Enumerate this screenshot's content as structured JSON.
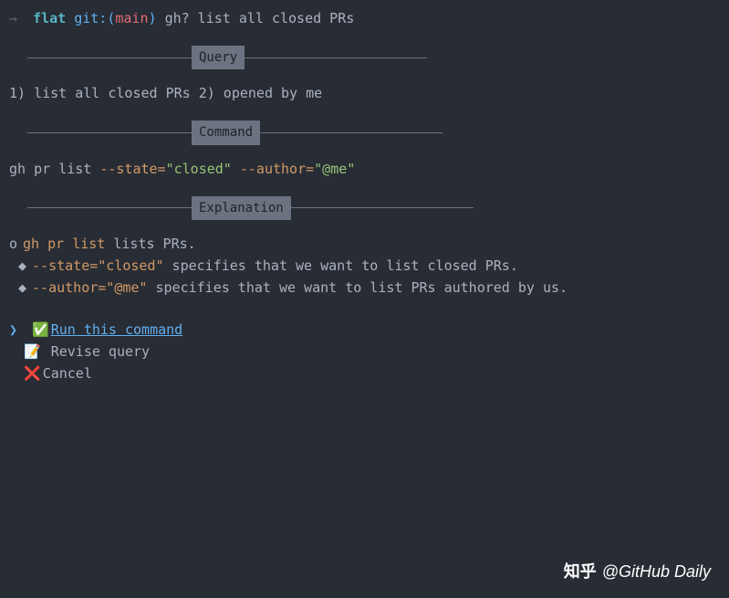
{
  "prompt": {
    "arrow": "→",
    "dir": "flat",
    "git_label": "git:",
    "paren_open": "(",
    "branch": "main",
    "paren_close": ")",
    "command": "gh? list all closed PRs"
  },
  "sections": {
    "query_label": "Query",
    "command_label": "Command",
    "explanation_label": "Explanation"
  },
  "query": {
    "text": "1) list all closed PRs 2) opened by me"
  },
  "command": {
    "base": "gh pr list ",
    "flag1": "--state=",
    "val1": "\"closed\"",
    "sep": " ",
    "flag2": "--author=",
    "val2": "\"@me\""
  },
  "explanation": {
    "line1_bullet": "o",
    "line1_cmd": "gh pr list",
    "line1_text": " lists PRs.",
    "line2_bullet": "◆",
    "line2_flag": "--state=\"closed\"",
    "line2_text": " specifies that we want to list closed PRs.",
    "line3_bullet": "◆",
    "line3_flag": "--author=\"@me\"",
    "line3_text": " specifies that we want to list PRs authored by us."
  },
  "menu": {
    "marker": "❯",
    "items": [
      {
        "emoji": "✅",
        "label": "Run this command",
        "selected": true
      },
      {
        "emoji": "📝",
        "label": " Revise query",
        "selected": false
      },
      {
        "emoji": "❌",
        "label": "Cancel",
        "selected": false
      }
    ]
  },
  "watermark": {
    "zhihu": "知乎",
    "brand": "@GitHub Daily"
  }
}
